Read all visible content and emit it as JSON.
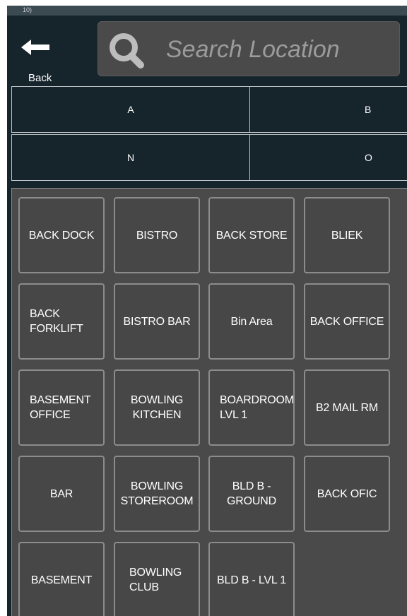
{
  "status_strip": "10)",
  "back": {
    "label": "Back"
  },
  "search": {
    "placeholder": "Search Location"
  },
  "alphabet_tabs": [
    {
      "label": "A"
    },
    {
      "label": "B"
    },
    {
      "label": "N"
    },
    {
      "label": "O"
    }
  ],
  "locations": [
    "BACK DOCK",
    "BISTRO",
    "BACK STORE",
    "BLIEK",
    "BACK FORKLIFT",
    "BISTRO BAR",
    "Bin Area",
    "BACK OFFICE",
    "BASEMENT OFFICE",
    "BOWLING KITCHEN",
    "BOARDROOM LVL 1",
    "B2 MAIL RM",
    "BAR",
    "BOWLING STOREROOM",
    "BLD B - GROUND",
    "BACK OFIC",
    "BASEMENT",
    "BOWLING CLUB",
    "BLD B - LVL 1"
  ],
  "colors": {
    "background": "#16242c",
    "panel": "#4a4a4a",
    "tile": "#474747",
    "tile_border": "#8c8c8c"
  }
}
